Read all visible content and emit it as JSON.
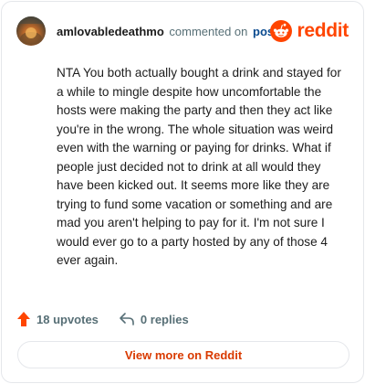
{
  "comment": {
    "username": "amlovabledeathmo",
    "action_text": "commented on",
    "post_link_text": "post",
    "text": "NTA You both actually bought a drink and stayed for a while to mingle despite how uncomfortable the hosts were making the party and then they act like you're in the wrong. The whole situation was weird even with the warning or paying for drinks. What if people just decided not to drink at all would they have been kicked out. It seems more like they are trying to fund some vacation or something and are mad you aren't helping to pay for it. I'm not sure I would ever go to a party hosted by any of those 4 ever again."
  },
  "brand": {
    "name": "reddit",
    "color": "#ff4500"
  },
  "actions": {
    "upvotes": "18 upvotes",
    "replies": "0 replies"
  },
  "footer": {
    "view_more": "View more on Reddit"
  },
  "icons": {
    "avatar": "user-avatar",
    "logo": "reddit-snoo-icon",
    "upvote": "upvote-arrow-icon",
    "reply": "reply-arrow-icon"
  }
}
